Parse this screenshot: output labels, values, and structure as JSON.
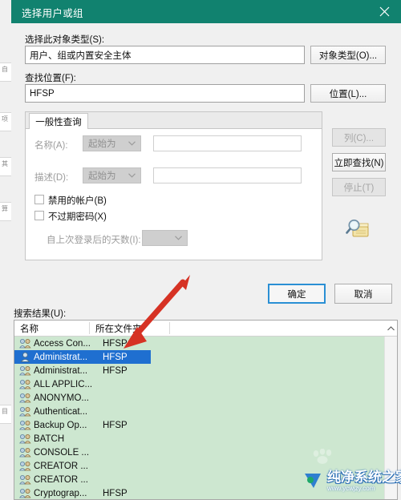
{
  "window": {
    "title": "选择用户或组",
    "close_icon": "close-x-icon",
    "titlebar_color": "#11826f"
  },
  "form": {
    "object_type_label": "选择此对象类型(S):",
    "object_type_value": "用户、组或内置安全主体",
    "object_type_button": "对象类型(O)...",
    "location_label": "查找位置(F):",
    "location_value": "HFSP",
    "location_button": "位置(L)..."
  },
  "query_panel": {
    "tab_label": "一般性查询",
    "name_label": "名称(A):",
    "name_condition": "起始为",
    "name_value": "",
    "desc_label": "描述(D):",
    "desc_condition": "起始为",
    "desc_value": "",
    "disabled_accounts_label": "禁用的帐户(B)",
    "disabled_accounts_checked": false,
    "nonexpiring_password_label": "不过期密码(X)",
    "nonexpiring_password_checked": false,
    "days_since_login_label": "自上次登录后的天数(I):",
    "days_since_login_value": ""
  },
  "side_buttons": {
    "columns": "列(C)...",
    "columns_enabled": false,
    "find_now": "立即查找(N)",
    "find_now_enabled": true,
    "stop": "停止(T)",
    "stop_enabled": false,
    "search_icon": "magnifier-folder-icon"
  },
  "dialog_buttons": {
    "ok": "确定",
    "cancel": "取消"
  },
  "results": {
    "label": "搜索结果(U):",
    "columns": [
      "名称",
      "所在文件夹"
    ],
    "scroll_up_icon": "chevron-up-icon",
    "rows": [
      {
        "icon": "group-icon",
        "name": "Access Con...",
        "folder": "HFSP",
        "selected": false
      },
      {
        "icon": "user-icon",
        "name": "Administrat...",
        "folder": "HFSP",
        "selected": true
      },
      {
        "icon": "group-icon",
        "name": "Administrat...",
        "folder": "HFSP",
        "selected": false
      },
      {
        "icon": "group-icon",
        "name": "ALL APPLIC...",
        "folder": "",
        "selected": false
      },
      {
        "icon": "group-icon",
        "name": "ANONYMO...",
        "folder": "",
        "selected": false
      },
      {
        "icon": "group-icon",
        "name": "Authenticat...",
        "folder": "",
        "selected": false
      },
      {
        "icon": "group-icon",
        "name": "Backup Op...",
        "folder": "HFSP",
        "selected": false
      },
      {
        "icon": "group-icon",
        "name": "BATCH",
        "folder": "",
        "selected": false
      },
      {
        "icon": "group-icon",
        "name": "CONSOLE ...",
        "folder": "",
        "selected": false
      },
      {
        "icon": "group-icon",
        "name": "CREATOR ...",
        "folder": "",
        "selected": false
      },
      {
        "icon": "group-icon",
        "name": "CREATOR ...",
        "folder": "",
        "selected": false
      },
      {
        "icon": "group-icon",
        "name": "Cryptograp...",
        "folder": "HFSP",
        "selected": false
      }
    ]
  },
  "annotation": {
    "arrow_color": "#d63224",
    "arrow_name": "red-pointer-arrow"
  },
  "watermark": {
    "title": "纯净系统之家",
    "url": "www.ycwjzy.com"
  }
}
